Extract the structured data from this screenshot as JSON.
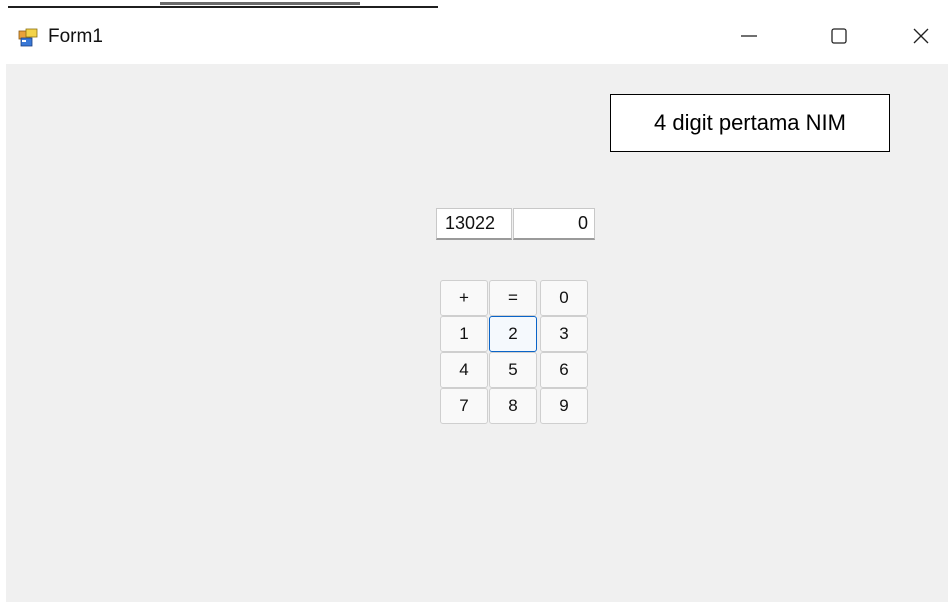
{
  "window": {
    "title": "Form1",
    "icons": [
      "app-icon",
      "minimize-icon",
      "maximize-icon",
      "close-icon"
    ]
  },
  "callout": {
    "text": "4 digit pertama NIM"
  },
  "display": {
    "input_value": "13022",
    "result_value": "0"
  },
  "keypad": {
    "rows": [
      [
        "+",
        "=",
        "0"
      ],
      [
        "1",
        "2",
        "3"
      ],
      [
        "4",
        "5",
        "6"
      ],
      [
        "7",
        "8",
        "9"
      ]
    ],
    "focused_key": "2"
  },
  "colors": {
    "client_bg": "#f0f0f0",
    "focus_border": "#0a64c8"
  }
}
